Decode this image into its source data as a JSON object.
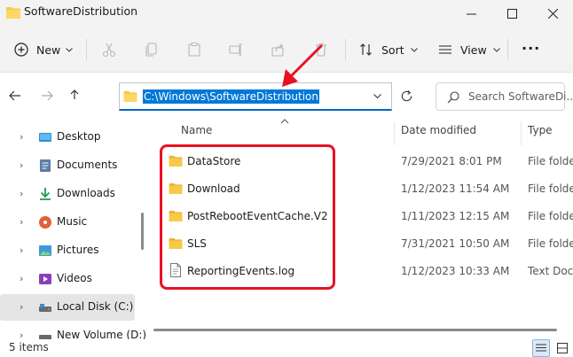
{
  "window": {
    "title": "SoftwareDistribution"
  },
  "toolbar": {
    "new_label": "New",
    "sort_label": "Sort",
    "view_label": "View",
    "more_label": "···"
  },
  "address": {
    "path": "C:\\Windows\\SoftwareDistribution"
  },
  "search": {
    "placeholder": "Search SoftwareDi..."
  },
  "sidebar": {
    "items": [
      {
        "label": "Desktop",
        "icon": "desktop-icon"
      },
      {
        "label": "Documents",
        "icon": "documents-icon"
      },
      {
        "label": "Downloads",
        "icon": "downloads-icon"
      },
      {
        "label": "Music",
        "icon": "music-icon"
      },
      {
        "label": "Pictures",
        "icon": "pictures-icon"
      },
      {
        "label": "Videos",
        "icon": "videos-icon"
      },
      {
        "label": "Local Disk (C:)",
        "icon": "drive-icon",
        "selected": true
      },
      {
        "label": "New Volume (D:)",
        "icon": "drive-icon"
      }
    ]
  },
  "columns": {
    "name": "Name",
    "date": "Date modified",
    "type": "Type"
  },
  "files": [
    {
      "name": "DataStore",
      "date": "7/29/2021 8:01 PM",
      "type": "File folder",
      "kind": "folder"
    },
    {
      "name": "Download",
      "date": "1/12/2023 11:54 AM",
      "type": "File folder",
      "kind": "folder"
    },
    {
      "name": "PostRebootEventCache.V2",
      "date": "1/11/2023 12:15 AM",
      "type": "File folder",
      "kind": "folder"
    },
    {
      "name": "SLS",
      "date": "7/31/2021 10:50 AM",
      "type": "File folder",
      "kind": "folder"
    },
    {
      "name": "ReportingEvents.log",
      "date": "1/12/2023 10:33 AM",
      "type": "Text Docu",
      "kind": "file"
    }
  ],
  "status": {
    "items_count": "5 items"
  },
  "colors": {
    "accent": "#0078d7",
    "highlight": "#e81123",
    "folder": "#f8c948"
  }
}
